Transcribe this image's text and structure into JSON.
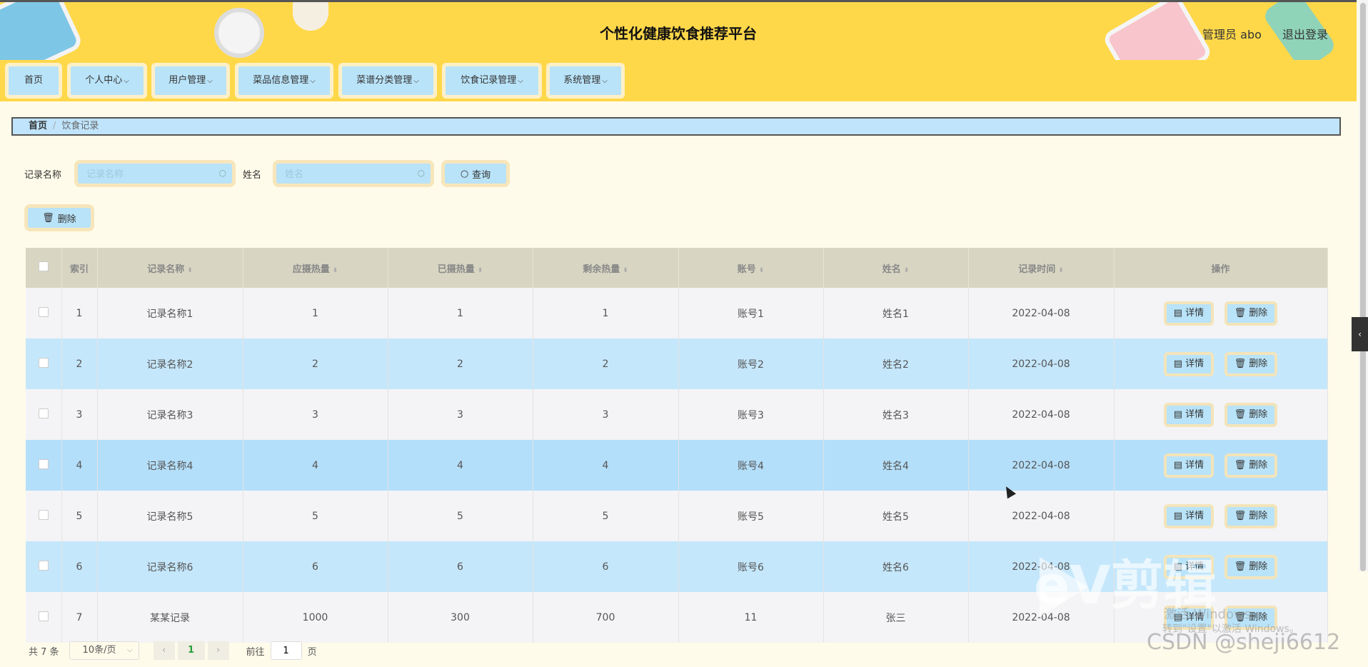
{
  "header": {
    "title": "个性化健康饮食推荐平台",
    "user_label": "管理员 abo",
    "logout_label": "退出登录"
  },
  "nav": [
    {
      "label": "首页",
      "has_dropdown": false
    },
    {
      "label": "个人中心",
      "has_dropdown": true
    },
    {
      "label": "用户管理",
      "has_dropdown": true
    },
    {
      "label": "菜品信息管理",
      "has_dropdown": true
    },
    {
      "label": "菜谱分类管理",
      "has_dropdown": true
    },
    {
      "label": "饮食记录管理",
      "has_dropdown": true
    },
    {
      "label": "系统管理",
      "has_dropdown": true
    }
  ],
  "breadcrumb": {
    "home": "首页",
    "separator": "/",
    "current": "饮食记录"
  },
  "search": {
    "record_name_label": "记录名称",
    "record_name_placeholder": "记录名称",
    "name_label": "姓名",
    "name_placeholder": "姓名",
    "query_label": "查询"
  },
  "toolbar": {
    "delete_label": "删除"
  },
  "table": {
    "columns": [
      "索引",
      "记录名称",
      "应摄热量",
      "已摄热量",
      "剩余热量",
      "账号",
      "姓名",
      "记录时间",
      "操作"
    ],
    "rows": [
      {
        "index": "1",
        "record_name": "记录名称1",
        "target": "1",
        "consumed": "1",
        "remaining": "1",
        "account": "账号1",
        "name": "姓名1",
        "time": "2022-04-08"
      },
      {
        "index": "2",
        "record_name": "记录名称2",
        "target": "2",
        "consumed": "2",
        "remaining": "2",
        "account": "账号2",
        "name": "姓名2",
        "time": "2022-04-08"
      },
      {
        "index": "3",
        "record_name": "记录名称3",
        "target": "3",
        "consumed": "3",
        "remaining": "3",
        "account": "账号3",
        "name": "姓名3",
        "time": "2022-04-08"
      },
      {
        "index": "4",
        "record_name": "记录名称4",
        "target": "4",
        "consumed": "4",
        "remaining": "4",
        "account": "账号4",
        "name": "姓名4",
        "time": "2022-04-08"
      },
      {
        "index": "5",
        "record_name": "记录名称5",
        "target": "5",
        "consumed": "5",
        "remaining": "5",
        "account": "账号5",
        "name": "姓名5",
        "time": "2022-04-08"
      },
      {
        "index": "6",
        "record_name": "记录名称6",
        "target": "6",
        "consumed": "6",
        "remaining": "6",
        "account": "账号6",
        "name": "姓名6",
        "time": "2022-04-08"
      },
      {
        "index": "7",
        "record_name": "某某记录",
        "target": "1000",
        "consumed": "300",
        "remaining": "700",
        "account": "11",
        "name": "张三",
        "time": "2022-04-08"
      }
    ],
    "detail_label": "详情",
    "delete_label": "删除"
  },
  "pagination": {
    "total": "共 7 条",
    "page_size": "10条/页",
    "current_page": "1",
    "goto_prefix": "前往",
    "goto_value": "1",
    "goto_suffix": "页"
  },
  "watermark": {
    "brand": "eV剪辑",
    "activate": "激活 Windows",
    "activate_hint": "转到\"设置\"以激活 Windows。",
    "csdn": "CSDN @sheji6612"
  },
  "colors": {
    "header_bg": "#ffd84a",
    "page_bg": "#fffbea",
    "button_bg": "#b9e3f8",
    "button_frame": "#f7e6bb",
    "row_alt": "#c5e7fb",
    "table_header": "#d8d6c3",
    "current_page": "#2a9d3a"
  }
}
